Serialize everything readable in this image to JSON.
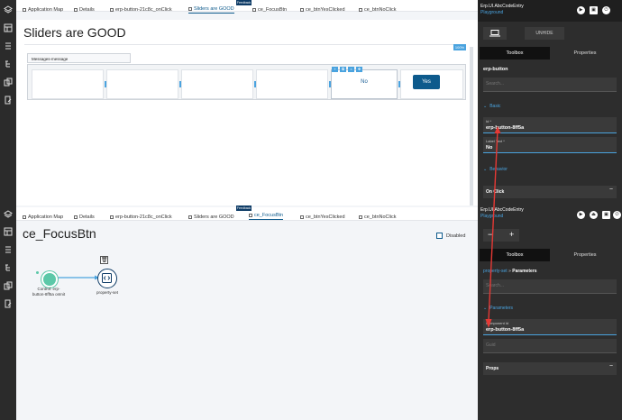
{
  "colors": {
    "accent": "#0d5a8c",
    "panel": "#2d2d2d",
    "node": "#5cc8a8"
  },
  "top": {
    "tabs": [
      {
        "label": "Application Map",
        "icon": "sitemap-icon"
      },
      {
        "label": "Details",
        "icon": "grid-icon"
      },
      {
        "label": "erp-button-21c8c_onClick",
        "icon": "flow-icon"
      },
      {
        "label": "Sliders are GOOD",
        "icon": "grid-icon"
      },
      {
        "label": "ce_FocusBtn",
        "icon": "flow-icon"
      },
      {
        "label": "ce_btnYesClicked",
        "icon": "flow-icon"
      },
      {
        "label": "ce_btnNoClick",
        "icon": "flow-icon"
      }
    ],
    "feedback": "Feedback",
    "page_title": "Sliders are GOOD",
    "zoom": "100%",
    "message_label": "Messages-message",
    "no_label": "No",
    "yes_label": "Yes"
  },
  "bottom": {
    "tabs": [
      {
        "label": "Application Map",
        "icon": "sitemap-icon"
      },
      {
        "label": "Details",
        "icon": "grid-icon"
      },
      {
        "label": "erp-button-21c8c_onClick",
        "icon": "flow-icon"
      },
      {
        "label": "Sliders are GOOD",
        "icon": "grid-icon"
      },
      {
        "label": "ce_FocusBtn",
        "icon": "flow-icon"
      },
      {
        "label": "ce_btnYesClicked",
        "icon": "flow-icon"
      },
      {
        "label": "ce_btnNoClick",
        "icon": "flow-icon"
      }
    ],
    "feedback": "Feedback",
    "page_title": "ce_FocusBtn",
    "disabled_label": "Disabled",
    "node_start_label": "Control: erp-button-8ff5a onInit",
    "node_action_label": "property-set"
  },
  "right_top": {
    "title": "Erp.UI.AbcCodeEntry",
    "subtitle": "Playground",
    "unhide": "UNHIDE",
    "tabs": [
      "Toolbox",
      "Properties"
    ],
    "component": "erp-button",
    "search_placeholder": "Search...",
    "section_basic": "Basic",
    "id_label": "Id *",
    "id_value": "erp-button-8ff5a",
    "label_text_label": "Label Text *",
    "label_text_value": "No",
    "section_behavior": "Behavior",
    "on_click": "On Click"
  },
  "right_bottom": {
    "title": "Erp.UI.AbcCodeEntry",
    "subtitle": "Playground",
    "zoom_minus": "−",
    "zoom_plus": "+",
    "tabs": [
      "Toolbox",
      "Properties"
    ],
    "breadcrumb_root": "property-set",
    "breadcrumb_sep": "»",
    "breadcrumb_current": "Parameters",
    "search_placeholder": "Search...",
    "section_parameters": "Parameters",
    "component_id_label": "Component Id",
    "component_id_value": "erp-button-8ff5a",
    "guid_placeholder": "Guid",
    "props_label": "Props"
  }
}
